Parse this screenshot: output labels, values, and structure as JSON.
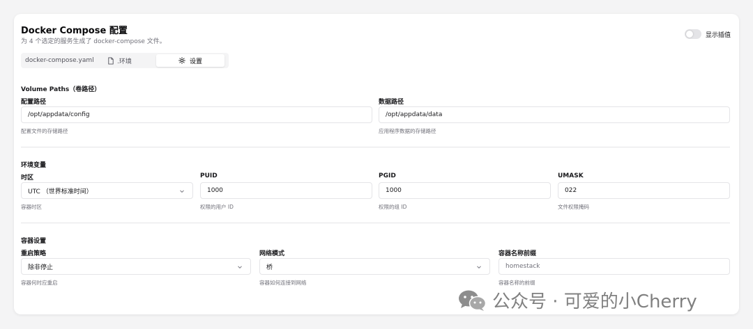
{
  "header": {
    "title": "Docker Compose 配置",
    "subtitle": "为 4 个选定的服务生成了 docker-compose 文件。",
    "toggle_label": "显示插值"
  },
  "tabs": [
    {
      "label": "docker-compose.yaml",
      "icon": ""
    },
    {
      "label": ".环境",
      "icon": "file-icon"
    },
    {
      "label": "设置",
      "icon": "gear-icon",
      "active": true
    }
  ],
  "volume": {
    "title": "Volume Paths（卷路径）",
    "config": {
      "label": "配置路径",
      "value": "/opt/appdata/config",
      "hint": "配置文件的存储路径"
    },
    "data": {
      "label": "数据路径",
      "value": "/opt/appdata/data",
      "hint": "应用程序数据的存储路径"
    }
  },
  "env": {
    "title": "环境变量",
    "timezone": {
      "label": "时区",
      "value": "UTC （世界标准时间）",
      "hint": "容器时区"
    },
    "puid": {
      "label": "PUID",
      "value": "1000",
      "hint": "权限的用户 ID"
    },
    "pgid": {
      "label": "PGID",
      "value": "1000",
      "hint": "权限的组 ID"
    },
    "umask": {
      "label": "UMASK",
      "value": "022",
      "hint": "文件权限掩码"
    }
  },
  "container": {
    "title": "容器设置",
    "restart": {
      "label": "重启策略",
      "value": "除非停止",
      "hint": "容器何时应重启"
    },
    "network": {
      "label": "网络模式",
      "value": "桥",
      "hint": "容器如何连接到网络"
    },
    "prefix": {
      "label": "容器名称前缀",
      "placeholder": "homestack",
      "hint": "容器名称的前缀"
    }
  },
  "watermark": {
    "text": "公众号 · 可爱的小Cherry"
  }
}
